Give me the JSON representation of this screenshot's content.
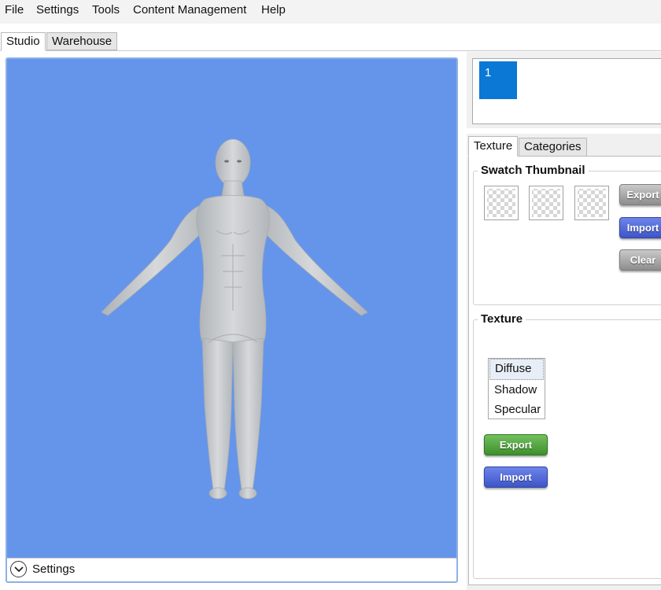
{
  "menu": [
    "File",
    "Settings",
    "Tools",
    "Content Management",
    "Help"
  ],
  "tabs": {
    "studio": "Studio",
    "warehouse": "Warehouse"
  },
  "viewport": {
    "settings_label": "Settings",
    "background_color": "#6595ea"
  },
  "slots": [
    {
      "label": "1",
      "selected": true
    }
  ],
  "panel_tabs": {
    "texture": "Texture",
    "categories": "Categories"
  },
  "swatch_thumbnail": {
    "title": "Swatch Thumbnail",
    "export_label": "Export",
    "import_label": "Import",
    "clear_label": "Clear"
  },
  "texture": {
    "title": "Texture",
    "items": [
      "Diffuse",
      "Shadow",
      "Specular"
    ],
    "selected": "Diffuse",
    "export_label": "Export",
    "import_label": "Import"
  },
  "colors": {
    "accent": "#0a78d4",
    "button_green": "#4fa53b",
    "button_blue": "#4a62d6",
    "button_gray": "#a3a3a3"
  }
}
